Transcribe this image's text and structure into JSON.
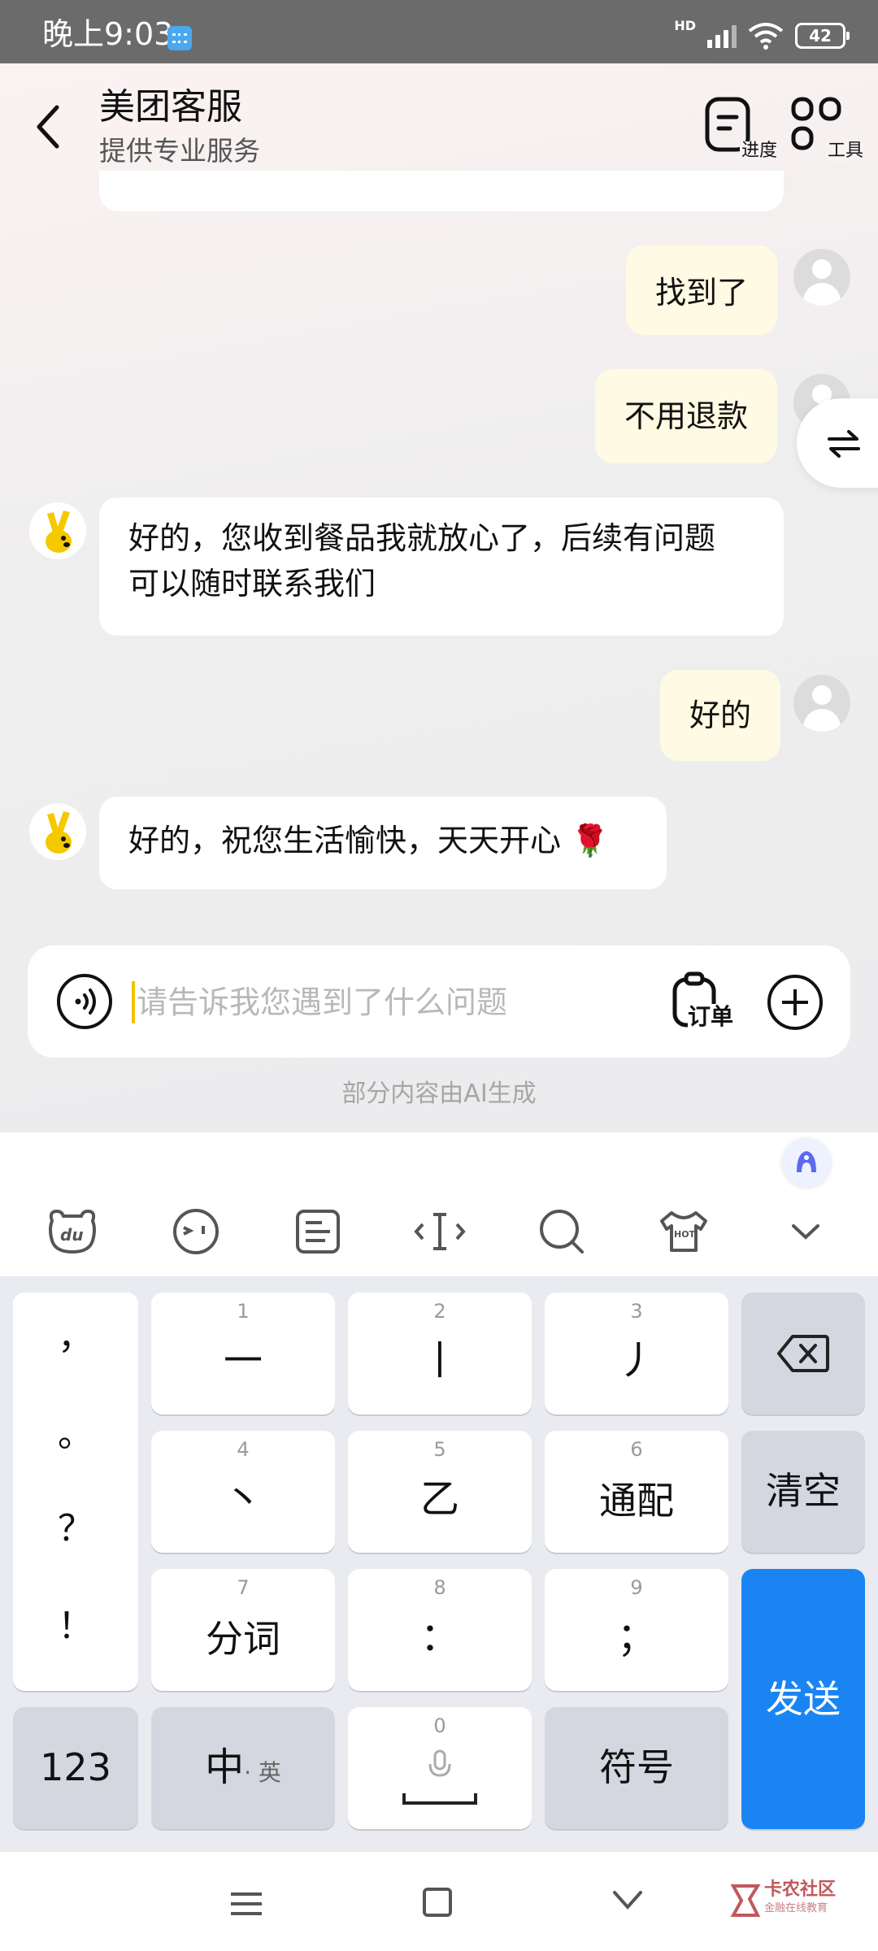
{
  "status_bar": {
    "time": "晚上9:03",
    "network": "HD",
    "battery": "42"
  },
  "header": {
    "title": "美团客服",
    "subtitle": "提供专业服务",
    "progress_label": "进度",
    "tools_label": "工具"
  },
  "messages": [
    {
      "from": "user",
      "text": "找到了"
    },
    {
      "from": "user",
      "text": "不用退款"
    },
    {
      "from": "bot",
      "line1": "好的，您收到餐品我就放心了，后续有问题",
      "line2": "可以随时联系我们"
    },
    {
      "from": "user",
      "text": "好的"
    },
    {
      "from": "bot",
      "text": "好的，祝您生活愉快，天天开心",
      "emoji": "🌹"
    }
  ],
  "input": {
    "placeholder": "请告诉我您遇到了什么问题",
    "order_label": "订单"
  },
  "ai_note": "部分内容由AI生成",
  "keyboard": {
    "punctuation": [
      "，",
      "。",
      "？",
      "！"
    ],
    "keys": [
      {
        "num": "1",
        "label": "一"
      },
      {
        "num": "2",
        "label": "丨"
      },
      {
        "num": "3",
        "label": "丿"
      },
      {
        "num": "4",
        "label": "丶"
      },
      {
        "num": "5",
        "label": "乙"
      },
      {
        "num": "6",
        "label": "通配"
      },
      {
        "num": "7",
        "label": "分词"
      },
      {
        "num": "8",
        "label": "："
      },
      {
        "num": "9",
        "label": "；"
      }
    ],
    "clear_label": "清空",
    "send_label": "发送",
    "num_mode_label": "123",
    "lang_main": "中",
    "lang_alt": "· 英",
    "space_num": "0",
    "symbols_label": "符号"
  },
  "watermark": {
    "name": "卡农社区",
    "sub": "金融在线教育"
  },
  "colors": {
    "user_bubble": "#fefae3",
    "send_key": "#1a85f2",
    "cursor": "#f2c200"
  }
}
